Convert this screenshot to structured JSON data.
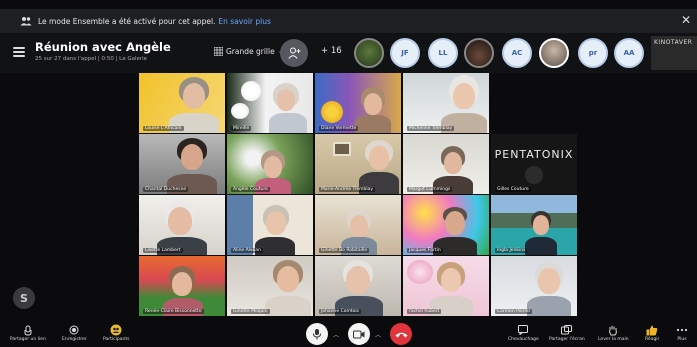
{
  "notification": {
    "message": "Le mode Ensemble a été activé pour cet appel.",
    "link": "En savoir plus"
  },
  "header": {
    "title": "Réunion avec Angèle",
    "subtitle": "25 sur 27 dans l'appel | 0:50 | La Galerie",
    "view_label": "Grande grille",
    "participant_extra": "+ 16",
    "avatars": [
      {
        "type": "photo"
      },
      {
        "type": "initials",
        "label": "JF"
      },
      {
        "type": "initials",
        "label": "LL"
      },
      {
        "type": "photo"
      },
      {
        "type": "initials",
        "label": "AC"
      },
      {
        "type": "photo"
      },
      {
        "type": "initials",
        "label": "pr"
      },
      {
        "type": "initials",
        "label": "AA"
      }
    ],
    "video_avatar_label": "KINOTAVER"
  },
  "tiles": [
    {
      "name": "Louise L'Africain"
    },
    {
      "name": "Mireille"
    },
    {
      "name": "Diane Vermette"
    },
    {
      "name": "Micheline Tremblay"
    },
    {
      "name": "Chantal Duchesne"
    },
    {
      "name": "Angèle Couture"
    },
    {
      "name": "Marie-Andrée Tremblay"
    },
    {
      "name": "Margot Cummings"
    },
    {
      "name": "Gilles Couture",
      "banner": "PENTATONIX"
    },
    {
      "name": "Lisette Lambert"
    },
    {
      "name": "Aline Alexan"
    },
    {
      "name": "Ginette Bo Robitaille"
    },
    {
      "name": "Jacques Fortin"
    },
    {
      "name": "Ingla Jenkins"
    },
    {
      "name": "Renée-Claire Bissonnette"
    },
    {
      "name": "Ginette Moquin"
    },
    {
      "name": "Johanne Comtois"
    },
    {
      "name": "rachel hubert"
    },
    {
      "name": "Carmen Poirier"
    }
  ],
  "toolbar": {
    "share_link": "Partager un lien",
    "record": "Enregistrer",
    "participants": "Participants",
    "captions": "Chevauchage",
    "share_screen": "Partager l'écran",
    "raise_hand": "Lever la main",
    "react": "Réagir",
    "more": "Plus"
  },
  "colors": {
    "accent": "#6aa8ff",
    "end_call": "#e0353c",
    "background": "#0b0b0d"
  }
}
